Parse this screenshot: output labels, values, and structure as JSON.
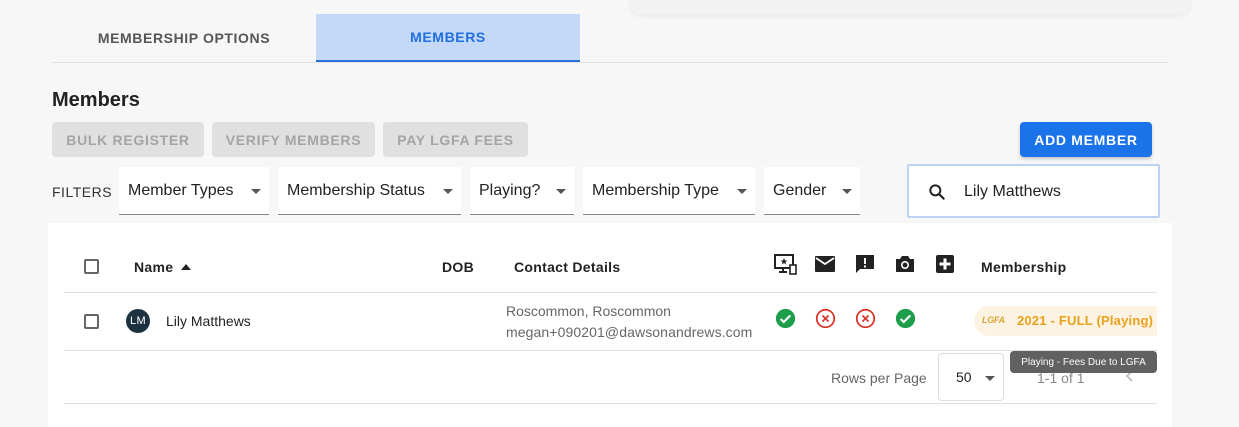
{
  "tabs": [
    {
      "label": "MEMBERSHIP OPTIONS",
      "active": false
    },
    {
      "label": "MEMBERS",
      "active": true
    }
  ],
  "page_title": "Members",
  "actions": {
    "bulk_register": "BULK REGISTER",
    "verify_members": "VERIFY MEMBERS",
    "pay_fees": "PAY LGFA FEES",
    "add_member": "ADD MEMBER"
  },
  "filters": {
    "label": "FILTERS",
    "items": [
      "Member Types",
      "Membership Status",
      "Playing?",
      "Membership Type",
      "Gender"
    ]
  },
  "search": {
    "value": "Lily Matthews",
    "icon": "search-icon"
  },
  "table": {
    "headers": {
      "name": "Name",
      "dob": "DOB",
      "contact": "Contact Details",
      "membership": "Membership"
    },
    "header_icons": [
      "computer-star-icon",
      "mail-icon",
      "feedback-icon",
      "camera-icon",
      "medical-cross-icon"
    ],
    "rows": [
      {
        "initials": "LM",
        "name": "Lily Matthews",
        "dob": "",
        "contact_line1": "Roscommon, Roscommon",
        "contact_line2": "megan+090201@dawsonandrews.com",
        "statuses": [
          "check",
          "cross",
          "cross",
          "check"
        ],
        "membership_logo": "LGFA",
        "membership": "2021 - FULL (Playing)"
      }
    ]
  },
  "pagination": {
    "rows_per_page_label": "Rows per Page",
    "rows_per_page": "50",
    "range": "1-1 of 1"
  },
  "tooltip": "Playing - Fees Due to LGFA",
  "colors": {
    "primary": "#1a73e8",
    "active_tab_bg": "#c4d8f7",
    "success": "#1e9e4a",
    "error": "#d93025",
    "membership": "#e8a21d"
  }
}
